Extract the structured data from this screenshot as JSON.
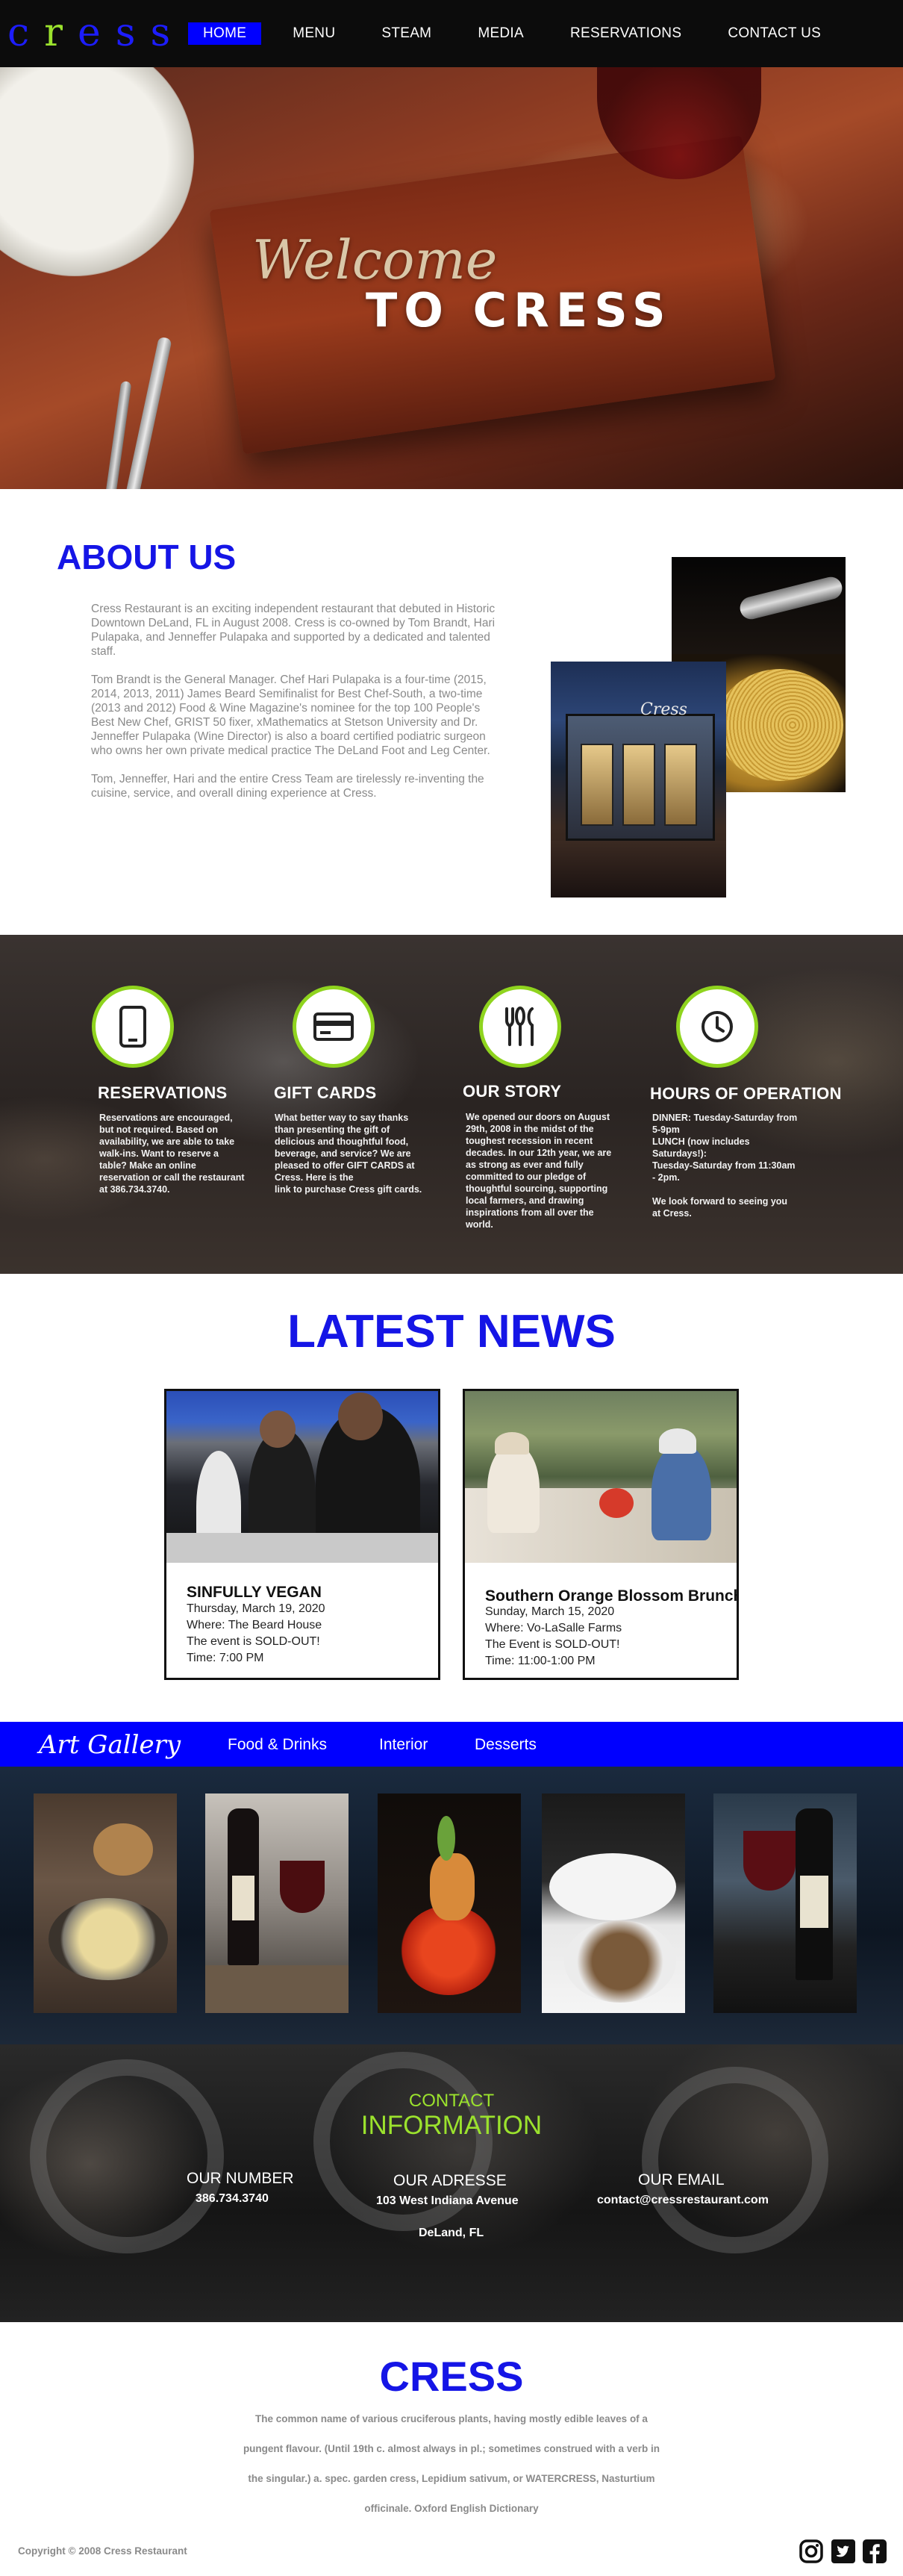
{
  "brand": {
    "logo_pre": "c",
    "logo_green": "r",
    "logo_post": "ess"
  },
  "nav": {
    "items": [
      {
        "label": "HOME",
        "active": true
      },
      {
        "label": "MENU"
      },
      {
        "label": "STEAM"
      },
      {
        "label": "MEDIA"
      },
      {
        "label": "RESERVATIONS"
      },
      {
        "label": "CONTACT US"
      }
    ]
  },
  "hero": {
    "welcome": "Welcome",
    "subtitle": "TO CRESS"
  },
  "about": {
    "title": "ABOUT US",
    "paragraphs": [
      "Cress Restaurant is an exciting independent restaurant that debuted in Historic Downtown DeLand, FL in August 2008. Cress is co-owned by Tom Brandt, Hari Pulapaka, and Jenneffer Pulapaka and supported by a dedicated and talented staff.",
      "Tom Brandt is the General Manager. Chef Hari Pulapaka is a four-time (2015, 2014, 2013, 2011) James Beard Semifinalist for Best Chef-South, a two-time (2013 and 2012) Food & Wine Magazine's nominee for the top 100 People's Best New Chef, GRIST 50 fixer, xMathematics at Stetson University and Dr. Jenneffer Pulapaka (Wine Director) is also a board certified podiatric surgeon who owns her own private medical practice The DeLand Foot and Leg Center.",
      "Tom, Jenneffer, Hari and the entire Cress Team are tirelessly re-inventing the cuisine, service, and overall dining experience at Cress."
    ],
    "storefront_sign": "Cress"
  },
  "services": [
    {
      "title": "RESERVATIONS",
      "icon": "phone-icon",
      "text": "Reservations are encouraged,\nbut not required. Based on\navailability, we are able to take\nwalk-ins. Want to reserve a\ntable? Make an online\nreservation or call the restaurant\nat 386.734.3740."
    },
    {
      "title": "GIFT CARDS",
      "icon": "credit-card-icon",
      "text": "What better way to say thanks\nthan presenting the gift of\ndelicious and thoughtful food,\nbeverage, and service? We are\npleased to offer GIFT CARDS at\nCress. Here is the\nlink to purchase Cress gift cards."
    },
    {
      "title": "OUR STORY",
      "icon": "cutlery-icon",
      "text": "We opened our doors on August\n29th, 2008 in the midst of the\ntoughest recession in recent\ndecades. In our 12th year, we are\nas strong as ever and fully\ncommitted to our pledge of\nthoughtful sourcing, supporting\nlocal farmers, and drawing\ninspirations from all over the\nworld."
    },
    {
      "title": "HOURS OF OPERATION",
      "icon": "clock-icon",
      "text": "DINNER: Tuesday-Saturday from\n5-9pm\nLUNCH (now includes\nSaturdays!):\nTuesday-Saturday from 11:30am\n- 2pm.\n\nWe look forward to seeing you\nat Cress."
    }
  ],
  "news": {
    "title": "LATEST NEWS",
    "events": [
      {
        "title": "SINFULLY VEGAN",
        "date": "Thursday, March 19, 2020",
        "where": "Where: The Beard House",
        "status": "The event is SOLD-OUT!",
        "time": "Time: 7:00 PM"
      },
      {
        "title": "Southern Orange Blossom Brunch",
        "date": "Sunday, March 15, 2020",
        "where": "Where: Vo-LaSalle Farms",
        "status": "The Event is SOLD-OUT!",
        "time": "Time: 11:00-1:00 PM"
      }
    ]
  },
  "gallery": {
    "title": "Art Gallery",
    "links": [
      "Food & Drinks",
      "Interior",
      "Desserts"
    ]
  },
  "contact": {
    "heading_small": "CONTACT",
    "heading_large": "INFORMATION",
    "number_label": "OUR NUMBER",
    "number": "386.734.3740",
    "address_label": "OUR ADRESSE",
    "address_line1": "103 West Indiana Avenue",
    "address_line2": "DeLand, FL",
    "email_label": "OUR EMAIL",
    "email": "contact@cressrestaurant.com"
  },
  "footer": {
    "title": "CRESS",
    "definition_lines": [
      "The common name of various cruciferous plants, having mostly edible leaves of a",
      "pungent flavour. (Until 19th c. almost always in pl.; sometimes construed with a verb in",
      "the singular.) a. spec. garden cress, Lepidium sativum, or WATERCRESS, Nasturtium",
      "officinale. Oxford English Dictionary"
    ],
    "copyright": "Copyright © 2008 Cress Restaurant",
    "social": [
      "instagram-icon",
      "twitter-icon",
      "facebook-icon"
    ]
  },
  "colors": {
    "accent_blue": "#0000ff",
    "accent_green": "#9be22d",
    "nav_bg": "#0c0c0c"
  }
}
